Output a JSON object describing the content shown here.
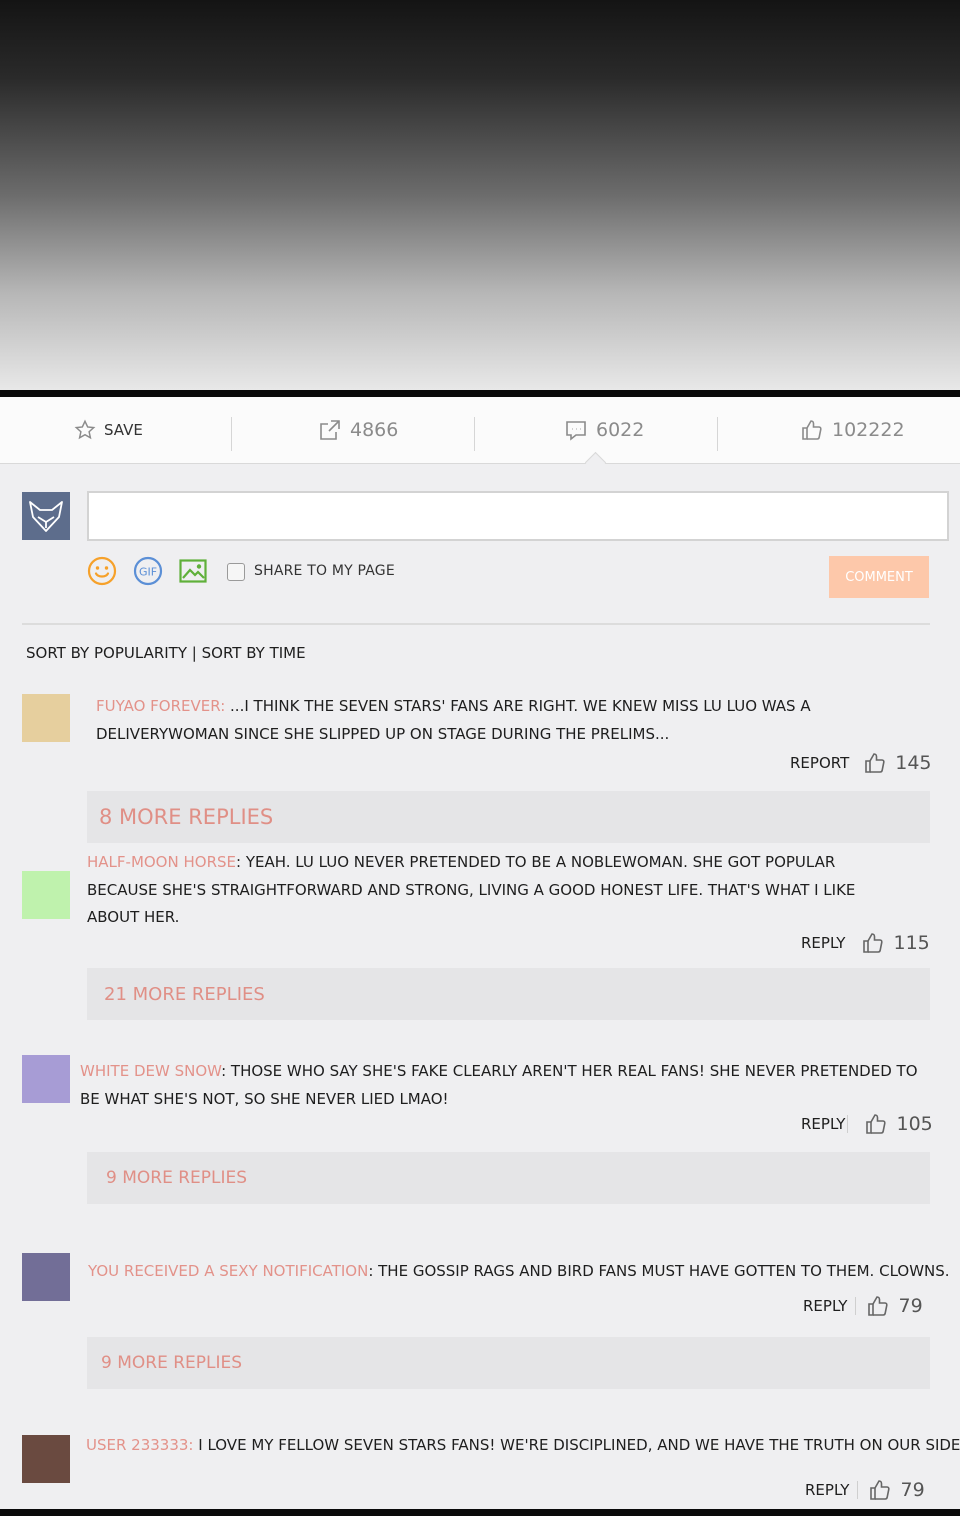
{
  "actions": {
    "save_label": "SAVE",
    "shares": "4866",
    "comments": "6022",
    "likes": "102222"
  },
  "composer": {
    "input_value": "",
    "share_label": "SHARE TO MY PAGE",
    "comment_button": "COMMENT"
  },
  "sort": {
    "popularity": "SORT BY POPULARITY",
    "separator": " | ",
    "time": "SORT BY TIME"
  },
  "colors": {
    "username": "#e3928a",
    "comment_button": "#fdc8aa",
    "avatar_1": "#e6cf9e",
    "avatar_2": "#bff2ad",
    "avatar_3": "#a79cd5",
    "avatar_4": "#726e97",
    "avatar_5": "#6a4a40"
  },
  "comments": [
    {
      "user": "FUYAO FOREVER:",
      "line1": " ...I THINK THE SEVEN STARS' FANS ARE RIGHT. WE KNEW MISS LU LUO WAS A",
      "line2": "DELIVERYWOMAN SINCE SHE SLIPPED UP ON STAGE DURING THE PRELIMS...",
      "action": "REPORT",
      "likes": "145",
      "more": "8 MORE REPLIES"
    },
    {
      "user": "HALF-MOON HORSE",
      "line1": ": YEAH. LU LUO NEVER PRETENDED TO BE A NOBLEWOMAN. SHE GOT POPULAR",
      "line2": "BECAUSE SHE'S STRAIGHTFORWARD AND STRONG, LIVING A GOOD HONEST LIFE. THAT'S WHAT I LIKE",
      "line3": "ABOUT HER.",
      "action": "REPLY",
      "likes": "115",
      "more": "21 MORE REPLIES"
    },
    {
      "user": "WHITE DEW SNOW",
      "line1": ": THOSE WHO SAY SHE'S FAKE CLEARLY AREN'T HER REAL FANS! SHE NEVER PRETENDED TO",
      "line2": "BE WHAT SHE'S NOT, SO SHE NEVER LIED LMAO!",
      "action": "REPLY",
      "likes": "105",
      "more": "9 MORE REPLIES"
    },
    {
      "user": "YOU RECEIVED A SEXY NOTIFICATION",
      "line1": ": THE GOSSIP RAGS AND BIRD FANS MUST HAVE GOTTEN TO THEM. CLOWNS.",
      "action": "REPLY",
      "likes": "79",
      "more": "9 MORE REPLIES"
    },
    {
      "user": "USER 233333:",
      "line1": " I LOVE MY FELLOW SEVEN STARS FANS! WE'RE DISCIPLINED, AND WE HAVE THE TRUTH ON OUR SIDE!",
      "action": "REPLY",
      "likes": "79"
    }
  ]
}
